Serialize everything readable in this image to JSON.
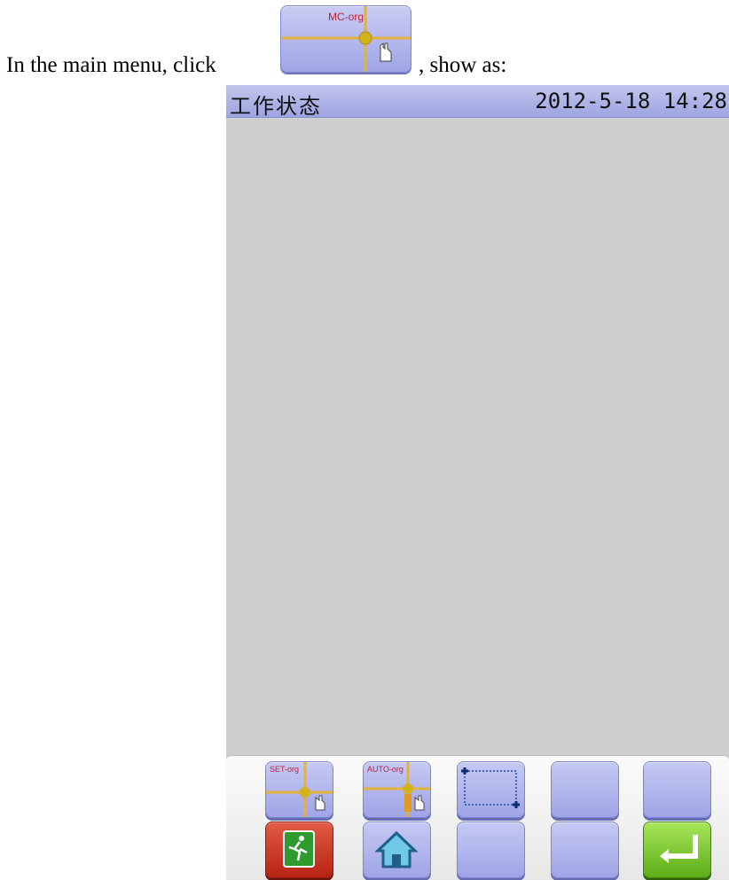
{
  "instruction": {
    "before_text": "In the main menu, click",
    "button_label": "MC-org",
    "after_text": ", show as:"
  },
  "device": {
    "title": "工作状态",
    "datetime": "2012-5-18 14:28"
  },
  "panel": {
    "row1": [
      {
        "name": "set-org",
        "label": "SET-org",
        "icon": "crosshair-hand-icon"
      },
      {
        "name": "auto-org",
        "label": "AUTO-org",
        "icon": "crosshair-hand-icon"
      },
      {
        "name": "frame",
        "label": "",
        "icon": "dotted-rectangle-icon"
      },
      {
        "name": "blank-1",
        "label": "",
        "icon": ""
      },
      {
        "name": "blank-2",
        "label": "",
        "icon": ""
      }
    ],
    "row2": [
      {
        "name": "exit",
        "label": "",
        "icon": "exit-running-man-icon"
      },
      {
        "name": "home",
        "label": "",
        "icon": "home-icon"
      },
      {
        "name": "blank-3",
        "label": "",
        "icon": ""
      },
      {
        "name": "blank-4",
        "label": "",
        "icon": ""
      },
      {
        "name": "enter",
        "label": "",
        "icon": "enter-arrow-icon"
      }
    ]
  }
}
